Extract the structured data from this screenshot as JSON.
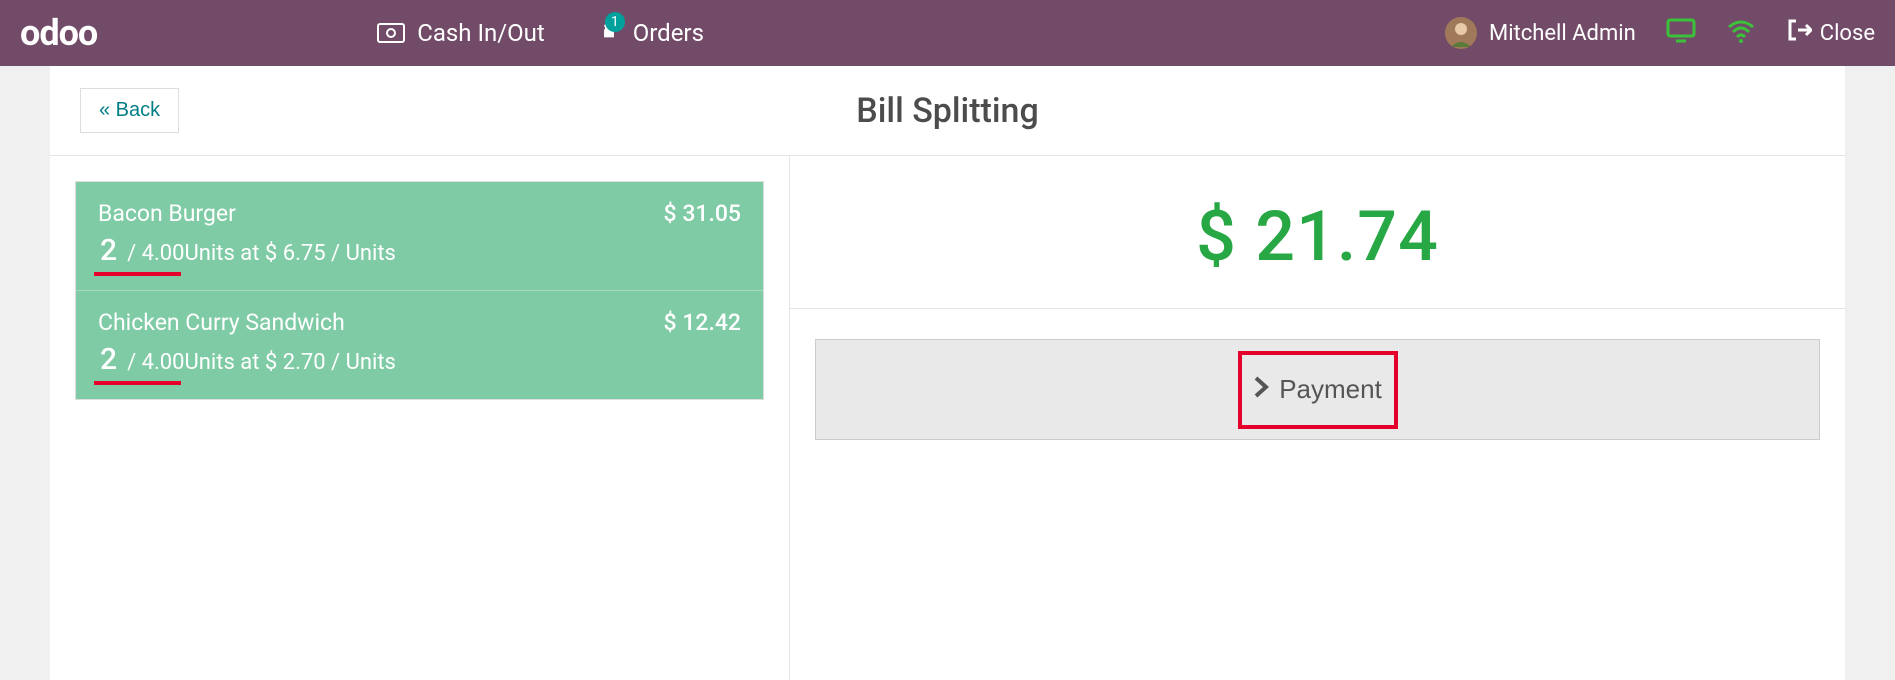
{
  "header": {
    "logo_text": "odoo",
    "cash_label": "Cash In/Out",
    "orders_label": "Orders",
    "orders_badge": "1",
    "user_name": "Mitchell Admin",
    "close_label": "Close"
  },
  "subheader": {
    "back_label": "« Back",
    "title": "Bill Splitting"
  },
  "order": {
    "lines": [
      {
        "name": "Bacon Burger",
        "price": "$ 31.05",
        "qty": "2",
        "detail": "/ 4.00Units at $ 6.75 / Units"
      },
      {
        "name": "Chicken Curry Sandwich",
        "price": "$ 12.42",
        "qty": "2",
        "detail": "/ 4.00Units at $ 2.70 / Units"
      }
    ]
  },
  "summary": {
    "total": "$ 21.74",
    "payment_label": "Payment"
  }
}
